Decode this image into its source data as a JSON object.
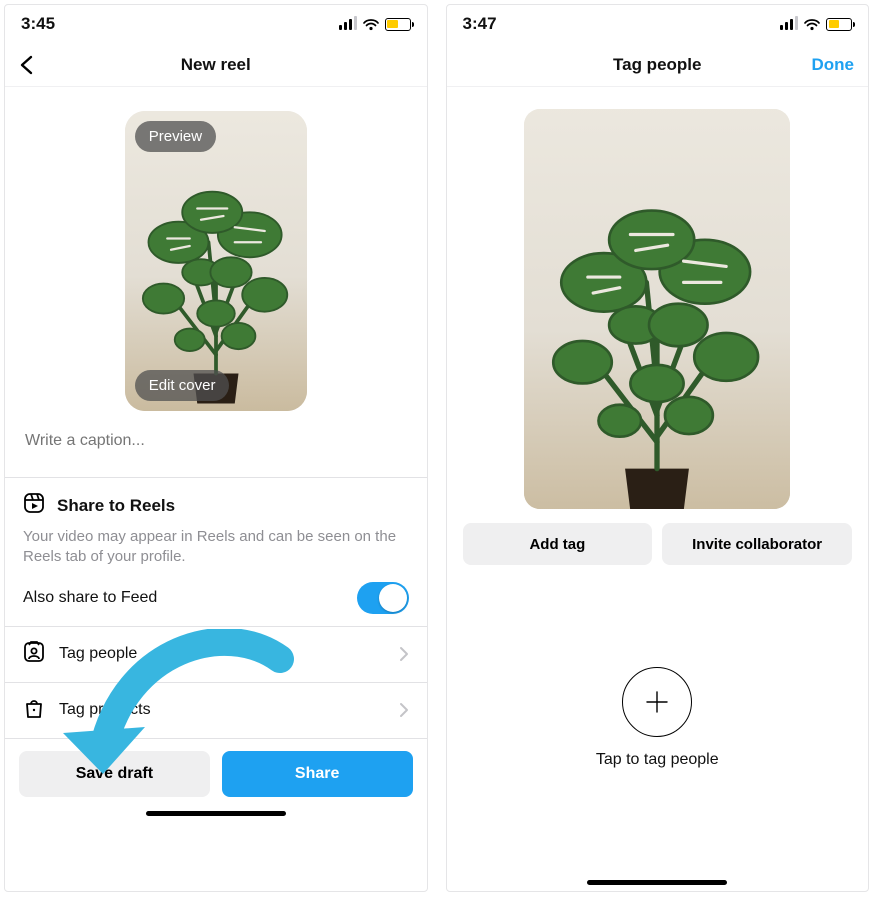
{
  "left": {
    "status_time": "3:45",
    "nav_title": "New reel",
    "thumb": {
      "preview_label": "Preview",
      "edit_cover_label": "Edit cover"
    },
    "caption_placeholder": "Write a caption...",
    "reels": {
      "title": "Share to Reels",
      "subtitle": "Your video may appear in Reels and can be seen on the Reels tab of your profile.",
      "feed_label": "Also share to Feed",
      "feed_on": true
    },
    "rows": {
      "tag_people": "Tag people",
      "tag_products": "Tag products"
    },
    "actions": {
      "save_draft": "Save draft",
      "share": "Share"
    }
  },
  "right": {
    "status_time": "3:47",
    "nav_title": "Tag people",
    "done_label": "Done",
    "buttons": {
      "add_tag": "Add tag",
      "invite_collab": "Invite collaborator"
    },
    "tap_label": "Tap to tag people"
  }
}
